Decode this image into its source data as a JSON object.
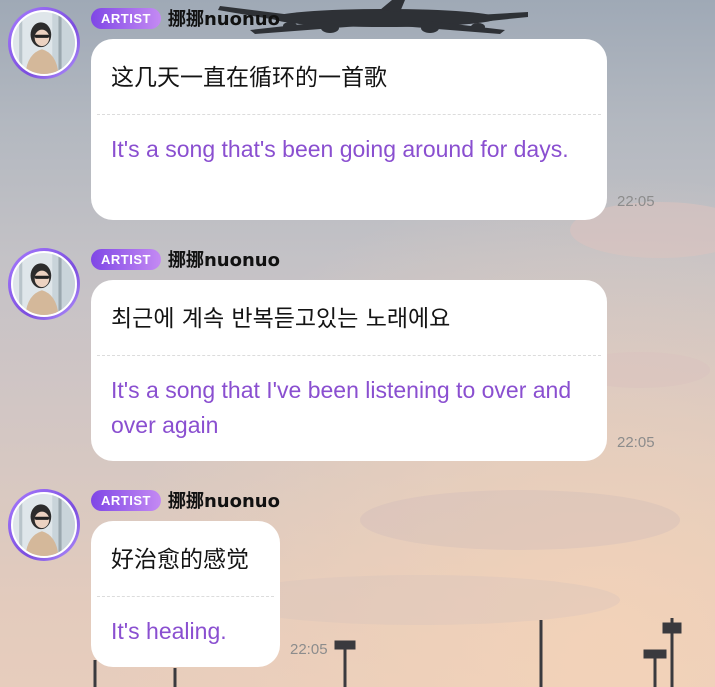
{
  "messages": [
    {
      "badge": "ARTIST",
      "username": "挪挪nuonuo",
      "original": "这几天一直在循环的一首歌",
      "translation": "It's a song that's been going around for days.",
      "time": "22:05"
    },
    {
      "badge": "ARTIST",
      "username": "挪挪nuonuo",
      "original": "최근에 계속 반복듣고있는 노래에요",
      "translation": "It's a song that I've been listening to over and over again",
      "time": "22:05"
    },
    {
      "badge": "ARTIST",
      "username": "挪挪nuonuo",
      "original": "好治愈的感觉",
      "translation": "It's healing.",
      "time": "22:05"
    }
  ],
  "icons": {
    "avatar": "avatar-photo",
    "airplane": "airplane-icon"
  }
}
